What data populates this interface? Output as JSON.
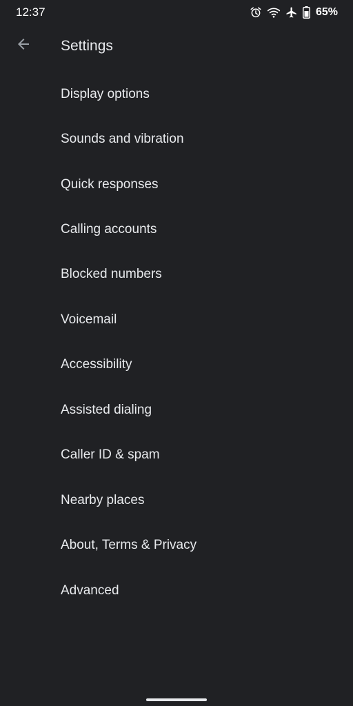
{
  "status_bar": {
    "time": "12:37",
    "battery_percent": "65%",
    "icons": [
      "alarm-icon",
      "wifi-icon",
      "airplane-mode-icon",
      "battery-icon"
    ]
  },
  "app_bar": {
    "title": "Settings",
    "back_icon": "arrow-back-icon"
  },
  "settings": {
    "items": [
      {
        "label": "Display options"
      },
      {
        "label": "Sounds and vibration"
      },
      {
        "label": "Quick responses"
      },
      {
        "label": "Calling accounts"
      },
      {
        "label": "Blocked numbers"
      },
      {
        "label": "Voicemail"
      },
      {
        "label": "Accessibility"
      },
      {
        "label": "Assisted dialing"
      },
      {
        "label": "Caller ID & spam"
      },
      {
        "label": "Nearby places"
      },
      {
        "label": "About, Terms & Privacy"
      },
      {
        "label": "Advanced"
      }
    ]
  },
  "colors": {
    "background": "#202124",
    "text_primary": "#e8eaed",
    "icon": "#9aa0a6"
  }
}
